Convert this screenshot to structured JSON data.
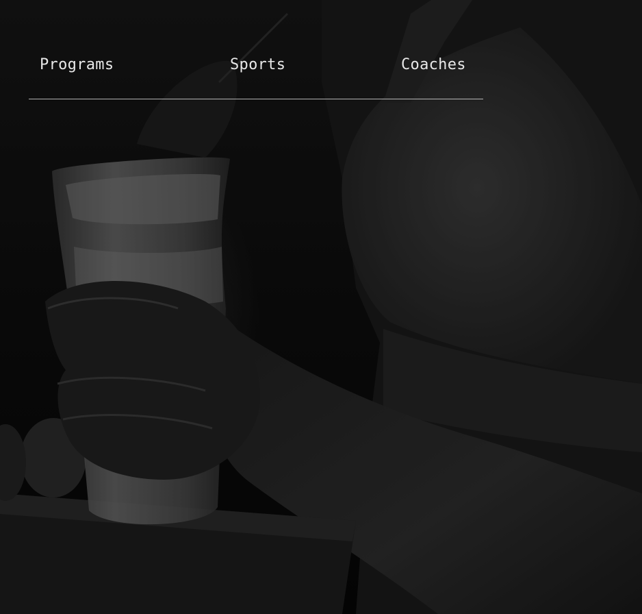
{
  "nav": {
    "items": [
      {
        "label": "Programs"
      },
      {
        "label": "Sports"
      },
      {
        "label": "Coaches"
      }
    ]
  }
}
